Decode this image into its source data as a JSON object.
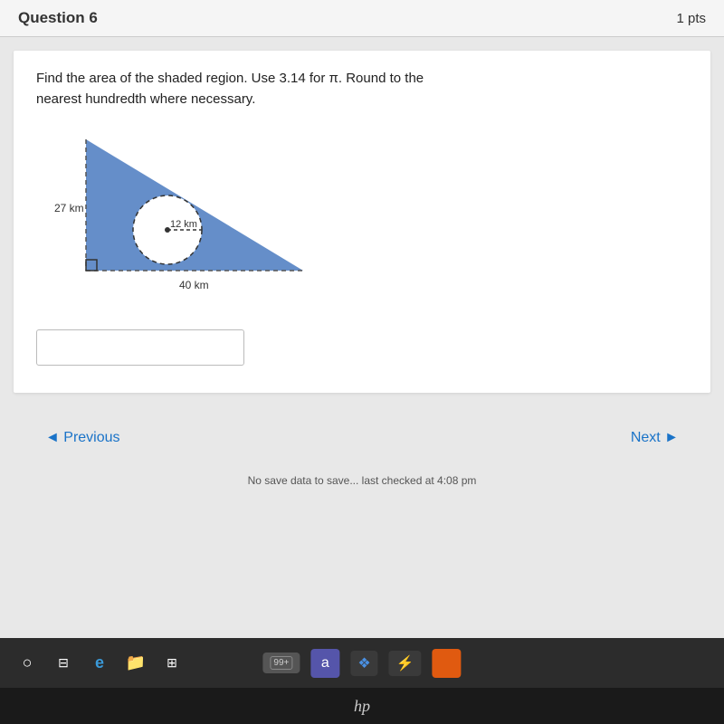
{
  "question": {
    "title": "Question 6",
    "points": "1 pts",
    "text_line1": "Find the area of the shaded region. Use 3.14 for π. Round to the",
    "text_line2": "nearest hundredth where necessary.",
    "diagram": {
      "triangle_side": "27 km",
      "triangle_base": "40 km",
      "circle_radius": "12 km"
    },
    "answer_placeholder": ""
  },
  "navigation": {
    "previous_label": "◄ Previous",
    "next_label": "Next ►"
  },
  "save_status": "No save data to save... last checked at 4:08 pm",
  "taskbar": {
    "apps": [
      "○",
      "⊞",
      "e",
      "📁",
      "⊞",
      "99+",
      "a",
      "❖",
      "⚡",
      "🟧"
    ]
  },
  "footer": {
    "brand": "hp"
  }
}
